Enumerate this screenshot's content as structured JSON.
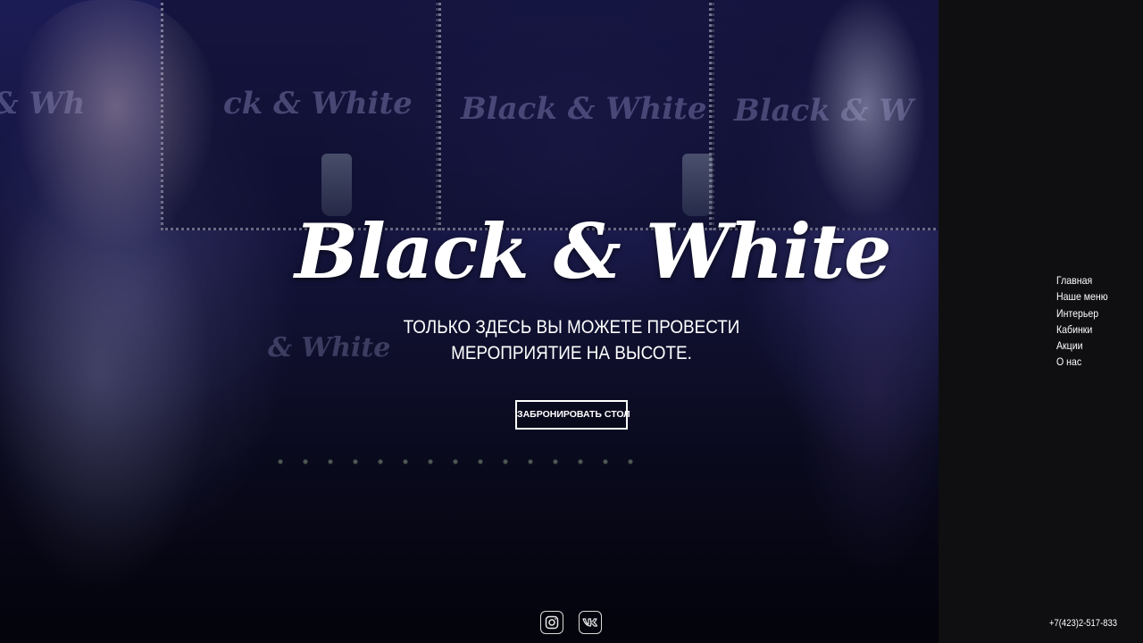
{
  "brand": {
    "logo_text": "Black & White"
  },
  "hero": {
    "tagline_line1": "ТОЛЬКО ЗДЕСЬ ВЫ МОЖЕТЕ ПРОВЕСТИ",
    "tagline_line2": "МЕРОПРИЯТИЕ НА ВЫСОТЕ.",
    "book_button_label": "ЗАБРОНИРОВАТЬ СТОЛ"
  },
  "nav": {
    "items": [
      {
        "label": "Главная"
      },
      {
        "label": "Наше меню"
      },
      {
        "label": "Интерьер"
      },
      {
        "label": "Кабинки"
      },
      {
        "label": "Акции"
      },
      {
        "label": "О нас"
      }
    ]
  },
  "social": {
    "items": [
      {
        "icon": "instagram-icon"
      },
      {
        "icon": "vk-icon"
      }
    ]
  },
  "contact": {
    "phone": "+7(423)2-517-833"
  },
  "colors": {
    "sidebar_bg": "#0f0f11",
    "text": "#ffffff",
    "hero_tint": "#1e1e5a"
  }
}
